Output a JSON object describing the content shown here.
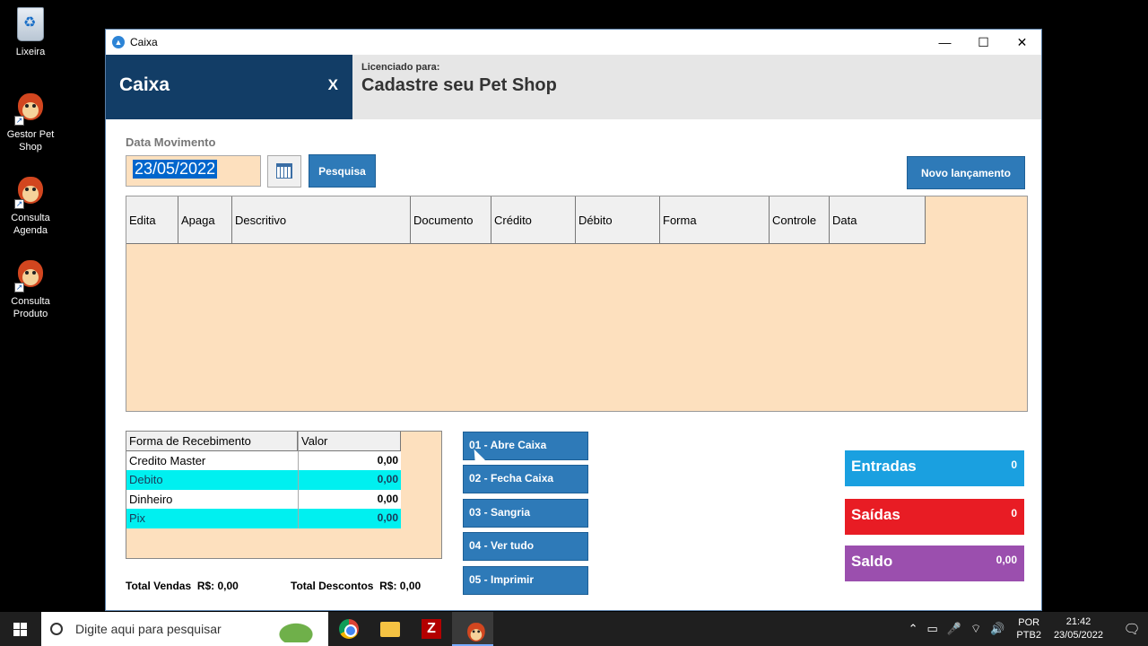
{
  "desktop": {
    "icons": [
      {
        "label": "Lixeira",
        "icon": "recycle-bin-icon"
      },
      {
        "label": "Gestor Pet Shop",
        "icon": "pet-shop-app-icon"
      },
      {
        "label": "Consulta Agenda",
        "icon": "pet-shop-app-icon"
      },
      {
        "label": "Consulta Produto",
        "icon": "pet-shop-app-icon"
      }
    ]
  },
  "window": {
    "title": "Caixa",
    "controls": {
      "minimize": "—",
      "maximize": "☐",
      "close": "✕"
    }
  },
  "header": {
    "title": "Caixa",
    "close_label": "X",
    "license_label": "Licenciado para:",
    "license_name": "Cadastre seu Pet Shop"
  },
  "filter": {
    "date_label": "Data Movimento",
    "date_value": "23/05/2022",
    "search_button": "Pesquisa",
    "new_entry_button": "Novo lançamento"
  },
  "grid": {
    "columns": [
      "Edita",
      "Apaga",
      "Descritivo",
      "Documento",
      "Crédito",
      "Débito",
      "Forma",
      "Controle",
      "Data"
    ],
    "rows": []
  },
  "receipts": {
    "columns": [
      "Forma de Recebimento",
      "Valor"
    ],
    "rows": [
      {
        "forma": "Credito Master",
        "valor": "0,00"
      },
      {
        "forma": "Debito",
        "valor": "0,00"
      },
      {
        "forma": "Dinheiro",
        "valor": "0,00"
      },
      {
        "forma": "Pix",
        "valor": "0,00"
      }
    ]
  },
  "totals": {
    "vendas_label": "Total Vendas",
    "vendas_value": "R$: 0,00",
    "descontos_label": "Total Descontos",
    "descontos_value": "R$: 0,00"
  },
  "actions": [
    "01 - Abre  Caixa",
    "02 -  Fecha Caixa",
    "03 - Sangria",
    "04 - Ver tudo",
    "05 - Imprimir"
  ],
  "stats": {
    "entradas": {
      "label": "Entradas",
      "value": "0",
      "color": "#1aa0e0"
    },
    "saidas": {
      "label": "Saídas",
      "value": "0",
      "color": "#e81c24"
    },
    "saldo": {
      "label": "Saldo",
      "value": "0,00",
      "color": "#9b4fae"
    }
  },
  "taskbar": {
    "search_placeholder": "Digite aqui para pesquisar",
    "lang_line1": "POR",
    "lang_line2": "PTB2",
    "time": "21:42",
    "date": "23/05/2022"
  }
}
